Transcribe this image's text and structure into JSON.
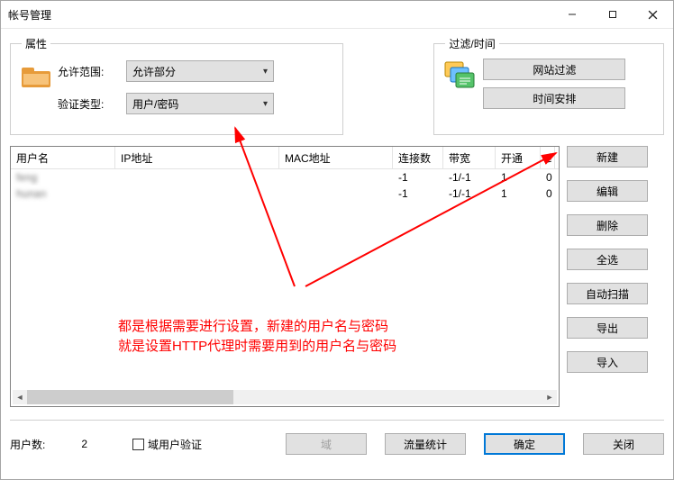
{
  "window": {
    "title": "帐号管理"
  },
  "group_attr": {
    "legend": "属性",
    "allow_label": "允许范围:",
    "allow_value": "允许部分",
    "auth_label": "验证类型:",
    "auth_value": "用户/密码"
  },
  "group_filter": {
    "legend": "过滤/时间",
    "btn_site": "网站过滤",
    "btn_time": "时间安排"
  },
  "columns": {
    "user": "用户名",
    "ip": "IP地址",
    "mac": "MAC地址",
    "conn": "连接数",
    "bw": "带宽",
    "open": "开通",
    "last": "纟"
  },
  "rows": [
    {
      "user": "feng",
      "ip": "",
      "mac": "",
      "conn": "-1",
      "bw": "-1/-1",
      "open": "1",
      "last": "0"
    },
    {
      "user": "hunan",
      "ip": "",
      "mac": "",
      "conn": "-1",
      "bw": "-1/-1",
      "open": "1",
      "last": "0"
    }
  ],
  "side": {
    "new": "新建",
    "edit": "编辑",
    "delete": "删除",
    "select_all": "全选",
    "autoscan": "自动扫描",
    "export": "导出",
    "import": "导入"
  },
  "bottom": {
    "count_label": "用户数:",
    "count_value": "2",
    "domain_auth": "域用户验证",
    "domain_btn": "域",
    "traffic_btn": "流量统计",
    "ok_btn": "确定",
    "close_btn": "关闭"
  },
  "annotation": {
    "line1": "都是根据需要进行设置，新建的用户名与密码",
    "line2": "就是设置HTTP代理时需要用到的用户名与密码"
  }
}
